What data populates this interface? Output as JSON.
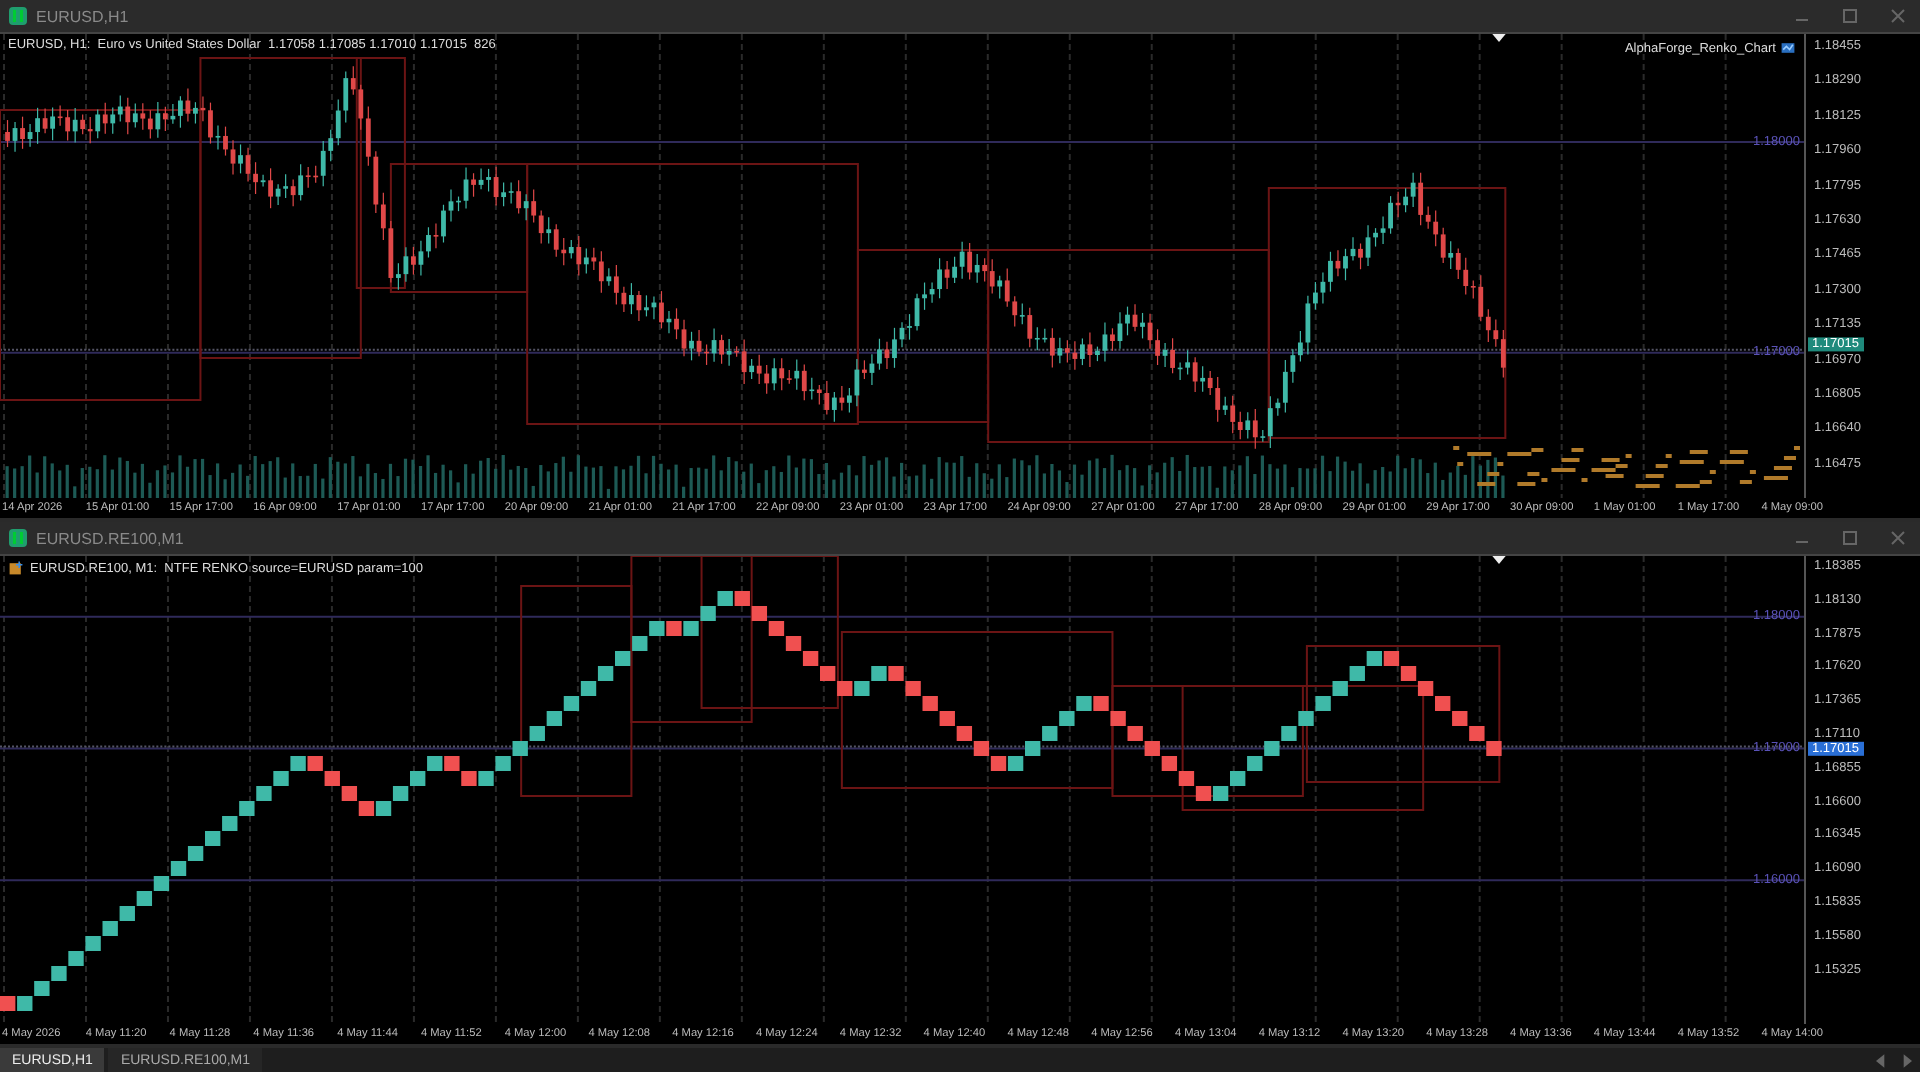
{
  "windows": [
    {
      "kind": "candles",
      "title": "EURUSD,H1",
      "info": "EURUSD, H1:  Euro vs United States Dollar  1.17058 1.17085 1.17010 1.17015  826",
      "indicator": "AlphaForge_Renko_Chart",
      "price_labels": [
        "1.18455",
        "1.18290",
        "1.18125",
        "1.17960",
        "1.17795",
        "1.17630",
        "1.17465",
        "1.17300",
        "1.17135",
        "1.16970",
        "1.16805",
        "1.16640",
        "1.16475"
      ],
      "current_price": "1.17015",
      "levels": [
        "1.18000",
        "1.17000"
      ],
      "time_labels": [
        "14 Apr 2026",
        "15 Apr 01:00",
        "15 Apr 17:00",
        "16 Apr 09:00",
        "17 Apr 01:00",
        "17 Apr 17:00",
        "20 Apr 09:00",
        "21 Apr 01:00",
        "21 Apr 17:00",
        "22 Apr 09:00",
        "23 Apr 01:00",
        "23 Apr 17:00",
        "24 Apr 09:00",
        "27 Apr 01:00",
        "27 Apr 17:00",
        "28 Apr 09:00",
        "29 Apr 01:00",
        "29 Apr 17:00",
        "30 Apr 09:00",
        "1 May 01:00",
        "1 May 17:00",
        "4 May 09:00"
      ]
    },
    {
      "kind": "renko",
      "title": "EURUSD.RE100,M1",
      "info": "EURUSD.RE100, M1:  NTFE RENKO source=EURUSD param=100",
      "price_labels": [
        "1.18385",
        "1.18130",
        "1.17875",
        "1.17620",
        "1.17365",
        "1.17110",
        "1.16855",
        "1.16600",
        "1.16345",
        "1.16090",
        "1.15835",
        "1.15580",
        "1.15325"
      ],
      "current_price": "1.17015",
      "levels": [
        "1.18000",
        "1.17000",
        "1.16000"
      ],
      "time_labels": [
        "4 May 2026",
        "4 May 11:20",
        "4 May 11:28",
        "4 May 11:36",
        "4 May 11:44",
        "4 May 11:52",
        "4 May 12:00",
        "4 May 12:08",
        "4 May 12:16",
        "4 May 12:24",
        "4 May 12:32",
        "4 May 12:40",
        "4 May 12:48",
        "4 May 12:56",
        "4 May 13:04",
        "4 May 13:12",
        "4 May 13:20",
        "4 May 13:28",
        "4 May 13:36",
        "4 May 13:44",
        "4 May 13:52",
        "4 May 14:00"
      ]
    }
  ],
  "tabs": [
    {
      "label": "EURUSD,H1",
      "selected": true
    },
    {
      "label": "EURUSD.RE100,M1",
      "selected": false
    }
  ]
}
